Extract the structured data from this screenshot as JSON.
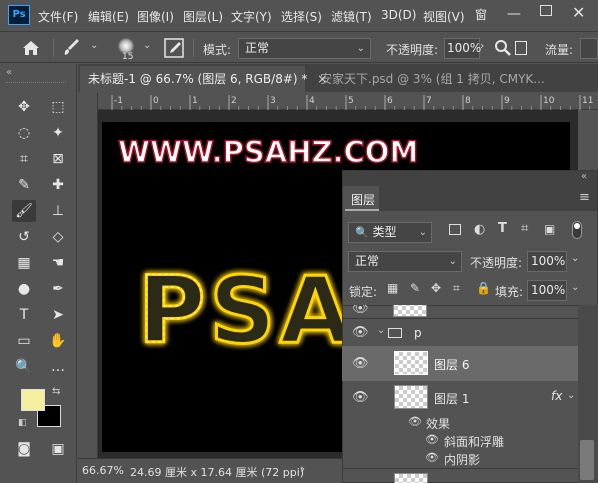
{
  "app": {
    "logo": "Ps"
  },
  "menu": [
    "文件(F)",
    "编辑(E)",
    "图像(I)",
    "图层(L)",
    "文字(Y)",
    "选择(S)",
    "滤镜(T)",
    "3D(D)",
    "视图(V)"
  ],
  "options": {
    "brush_size": "15",
    "mode_label": "模式:",
    "mode_value": "正常",
    "opacity_label": "不透明度:",
    "opacity_value": "100%",
    "flow_label": "流量:"
  },
  "tabs": [
    {
      "label": "未标题-1 @ 66.7% (图层 6, RGB/8#) *",
      "close": "×",
      "active": true
    },
    {
      "label": "安家天下.psd @ 3% (组 1 拷贝, CMYK...",
      "active": false
    }
  ],
  "ruler": {
    "h_ticks": [
      "-1",
      "0",
      "1",
      "2",
      "3",
      "4",
      "5",
      "6",
      "7",
      "8",
      "9",
      "10",
      "11"
    ]
  },
  "canvas": {
    "headline": "WWW.PSAHZ.COM",
    "neon_text": "PSA",
    "colors": {
      "background": "#000000",
      "headline_stroke": "#b0102a",
      "neon": "#ffd400"
    }
  },
  "status": {
    "zoom": "66.67%",
    "doc_size": "24.69 厘米 x 17.64 厘米 (72 ppi)",
    "arrow": "›"
  },
  "colors": {
    "foreground": "#f5f0a0",
    "background": "#000000",
    "accent_blue": "#31a8ff"
  },
  "layers_panel": {
    "title": "图层",
    "filter_label": "类型",
    "blend_mode": "正常",
    "opacity_label": "不透明度:",
    "opacity_value": "100%",
    "lock_label": "锁定:",
    "fill_label": "填充:",
    "fill_value": "100%",
    "group_name": "p",
    "layers": [
      {
        "name": "图层 6",
        "selected": true
      },
      {
        "name": "图层 1",
        "fx": "fx",
        "selected": false
      }
    ],
    "effects_label": "效果",
    "effects": [
      "斜面和浮雕",
      "内阴影"
    ]
  }
}
